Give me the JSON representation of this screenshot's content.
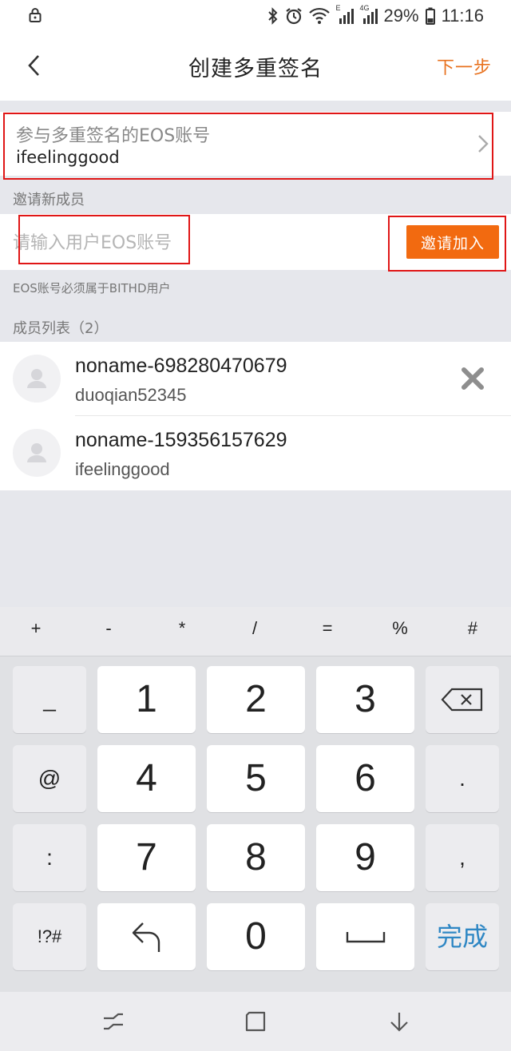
{
  "status_bar": {
    "battery": "29%",
    "time": "11:16",
    "network_e": "E",
    "network_4g": "4G"
  },
  "header": {
    "title": "创建多重签名",
    "next_label": "下一步"
  },
  "participants": {
    "label": "参与多重签名的EOS账号",
    "value": "ifeelinggood"
  },
  "invite": {
    "section_label": "邀请新成员",
    "placeholder": "请输入用户EOS账号",
    "button_label": "邀请加入",
    "hint": "EOS账号必须属于BITHD用户"
  },
  "members": {
    "section_label": "成员列表（2）",
    "items": [
      {
        "name": "noname-698280470679",
        "account": "duoqian52345"
      },
      {
        "name": "noname-159356157629",
        "account": "ifeelinggood"
      }
    ]
  },
  "keyboard": {
    "symbols": [
      "+",
      "-",
      "*",
      "/",
      "=",
      "%",
      "#"
    ],
    "digits": [
      "1",
      "2",
      "3",
      "4",
      "5",
      "6",
      "7",
      "8",
      "9",
      "0"
    ],
    "side_keys": [
      "_",
      "@",
      ":",
      "!?#",
      ".",
      ","
    ],
    "done_label": "完成"
  },
  "colors": {
    "accent": "#f26a10",
    "highlight_box": "#e01616",
    "done_key": "#2f87c4"
  }
}
